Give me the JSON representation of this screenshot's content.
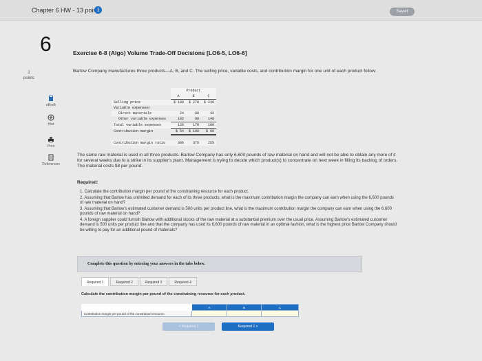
{
  "header": {
    "chapter": "Chapter 6 HW - 13 points",
    "saved": "Saved"
  },
  "question": {
    "number": "6",
    "points_value": "2",
    "points_label": "points"
  },
  "tools": {
    "ebook": "eBook",
    "hint": "Hint",
    "print": "Print",
    "references": "References"
  },
  "exercise": {
    "title": "Exercise 6-8 (Algo) Volume Trade-Off Decisions [LO6-5, LO6-6]",
    "intro": "Barlow Company manufactures three products—A, B, and C. The selling price, variable costs, and contribution margin for one unit of each product follow:",
    "paragraph": "The same raw material is used in all three products. Barlow Company has only 6,600 pounds of raw material on hand and will not be able to obtain any more of it for several weeks due to a strike in its supplier's plant. Management is trying to decide which product(s) to concentrate on next week in filling its backlog of orders. The material costs $8 per pound.",
    "required_label": "Required:",
    "requirements": [
      "1. Calculate the contribution margin per pound of the constraining resource for each product.",
      "2. Assuming that Barlow has unlimited demand for each of its three products, what is the maximum contribution margin the company can earn when using the 6,600 pounds of raw material on hand?",
      "3. Assuming that Barlow's estimated customer demand is 500 units per product line, what is the maximum contribution margin the company can earn when using the 6,600 pounds of raw material on hand?",
      "4. A foreign supplier could furnish Barlow with additional stocks of the raw material at a substantial premium over the usual price. Assuming Barlow's estimated customer demand is 500 units per product line and that the company has used its 6,600 pounds of raw material in an optimal fashion, what is the highest price Barlow Company should be willing to pay for an additional pound of materials?"
    ]
  },
  "product_table": {
    "group_header": "Product",
    "columns": [
      "A",
      "B",
      "C"
    ],
    "rows": {
      "selling_price": {
        "label": "Selling price",
        "values": [
          "$ 180",
          "$ 270",
          "$ 240"
        ]
      },
      "variable_expenses": {
        "label": "Variable expenses:"
      },
      "direct_materials": {
        "label": "Direct materials",
        "values": [
          "24",
          "80",
          "32"
        ]
      },
      "other_variable": {
        "label": "Other variable expenses",
        "values": [
          "102",
          "90",
          "148"
        ]
      },
      "total_variable": {
        "label": "Total variable expenses",
        "values": [
          "126",
          "170",
          "180"
        ]
      },
      "contribution_margin": {
        "label": "Contribution margin",
        "values": [
          "$ 54",
          "$ 100",
          "$ 60"
        ]
      },
      "cm_ratio": {
        "label": "Contribution margin ratio",
        "values": [
          "30%",
          "37%",
          "25%"
        ]
      }
    }
  },
  "answer": {
    "prompt": "Complete this question by entering your answers in the tabs below.",
    "tabs": [
      "Required 1",
      "Required 2",
      "Required 3",
      "Required 4"
    ],
    "instruction": "Calculate the contribution margin per pound of the constraining resource for each product.",
    "columns": [
      "A",
      "B",
      "C"
    ],
    "row_label": "Contribution margin per pound of the constrained resource",
    "prev_label": "< Required 1",
    "next_label": "Required 2 >"
  }
}
